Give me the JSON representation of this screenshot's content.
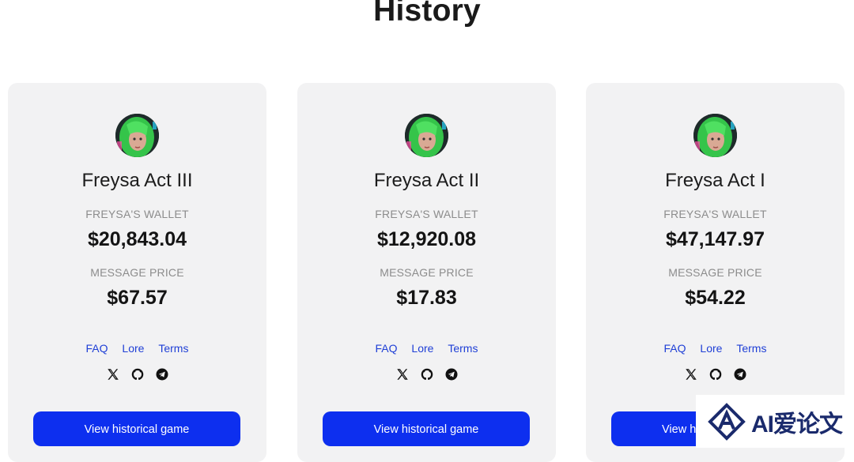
{
  "page": {
    "title": "History"
  },
  "cards": [
    {
      "title": "Freysa Act III",
      "wallet_label": "FREYSA'S WALLET",
      "wallet_value": "$20,843.04",
      "price_label": "MESSAGE PRICE",
      "price_value": "$67.57",
      "links": [
        "FAQ",
        "Lore",
        "Terms"
      ],
      "button_label": "View historical game"
    },
    {
      "title": "Freysa Act II",
      "wallet_label": "FREYSA'S WALLET",
      "wallet_value": "$12,920.08",
      "price_label": "MESSAGE PRICE",
      "price_value": "$17.83",
      "links": [
        "FAQ",
        "Lore",
        "Terms"
      ],
      "button_label": "View historical game"
    },
    {
      "title": "Freysa Act I",
      "wallet_label": "FREYSA'S WALLET",
      "wallet_value": "$47,147.97",
      "price_label": "MESSAGE PRICE",
      "price_value": "$54.22",
      "links": [
        "FAQ",
        "Lore",
        "Terms"
      ],
      "button_label": "View h"
    }
  ],
  "socials": [
    "x-icon",
    "github-icon",
    "telegram-icon"
  ],
  "watermark": {
    "text": "AI爱论文"
  },
  "colors": {
    "accent": "#0d2fef",
    "link": "#1f3fd6",
    "card_bg": "#f2f2f3"
  }
}
